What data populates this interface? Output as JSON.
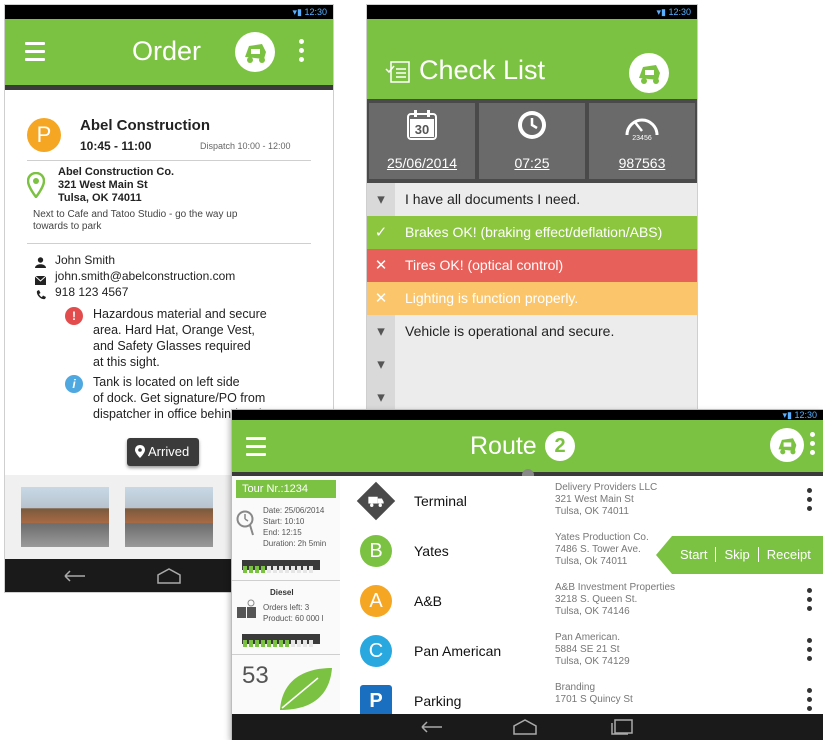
{
  "order": {
    "title": "Order",
    "customer": "Abel Construction",
    "customer_letter": "P",
    "time_window": "10:45 - 11:00",
    "dispatch": "Dispatch  10:00 - 12:00",
    "address": [
      "Abel Construction Co.",
      "321 West Main St",
      "Tulsa, OK 74011"
    ],
    "directions": [
      "Next to Cafe and Tatoo Studio - go the way up",
      "towards to park"
    ],
    "contact_name": "John Smith",
    "email": "john.smith@abelconstruction.com",
    "phone": "918 123 4567",
    "alert_icon": "!",
    "info_icon": "i",
    "notes": [
      [
        "Hazardous material and secure",
        "area.  Hard Hat, Orange Vest,",
        "and Safety Glasses required",
        "at this sight."
      ],
      [
        "Tank is located on left side",
        "of dock.  Get signature/PO from",
        "dispatcher in office behind tank"
      ]
    ],
    "arrived_label": "Arrived"
  },
  "checklist": {
    "title": "Check List",
    "date_day": "30",
    "date": "25/06/2014",
    "time": "07:25",
    "odometer_small": "23456",
    "odometer": "987563",
    "items": [
      {
        "label": "I have all documents I need.",
        "state": "open",
        "mark": "▾"
      },
      {
        "label": "Brakes OK! (braking effect/deflation/ABS)",
        "state": "ok",
        "mark": "✓"
      },
      {
        "label": "Tires OK! (optical control)",
        "state": "fail",
        "mark": "✕"
      },
      {
        "label": "Lighting is function properly.",
        "state": "warn",
        "mark": "✕"
      },
      {
        "label": "Vehicle is operational and secure.",
        "state": "open",
        "mark": "▾"
      },
      {
        "label": "",
        "state": "open",
        "mark": "▾"
      },
      {
        "label": "",
        "state": "open",
        "mark": "▾"
      }
    ]
  },
  "route": {
    "title": "Route",
    "count": "2",
    "tour": "Tour Nr.:1234",
    "date": "Date: 25/06/2014",
    "start": "Start: 10:10",
    "end": "End: 12:15",
    "duration": "Duration: 2h 5min",
    "fuel": "Diesel",
    "orders_left": "Orders left: 3",
    "product": "Product: 60 000 l",
    "score": "53",
    "stops": [
      {
        "icon": "truck",
        "letter": "",
        "name": "Terminal",
        "lines": [
          "Delivery Providers LLC",
          "321 West Main St",
          "Tulsa, OK 74011"
        ],
        "color": "#4a4a4a"
      },
      {
        "icon": "circle",
        "letter": "B",
        "name": "Yates",
        "lines": [
          "Yates Production Co.",
          "7486 S. Tower Ave.",
          "Tulsa, Ok 74011"
        ],
        "color": "#7cc242"
      },
      {
        "icon": "circle",
        "letter": "A",
        "name": "A&B",
        "lines": [
          "A&B Investment Properties",
          "3218 S. Queen St.",
          "Tulsa, OK 74146"
        ],
        "color": "#f5a623"
      },
      {
        "icon": "circle",
        "letter": "C",
        "name": "Pan American",
        "lines": [
          "Pan American.",
          "5884 SE 21 St",
          "Tulsa, OK 74129"
        ],
        "color": "#29a8e0"
      },
      {
        "icon": "square",
        "letter": "P",
        "name": "Parking",
        "lines": [
          "Branding",
          "1701 S Quincy St",
          ""
        ],
        "color": "#1a6fc0"
      }
    ],
    "actions": [
      "Start",
      "Skip",
      "Receipt"
    ]
  },
  "colors": {
    "brand": "#7cc242",
    "ok": "#8cc63f",
    "fail": "#e8605a",
    "warn": "#fbc66b"
  }
}
